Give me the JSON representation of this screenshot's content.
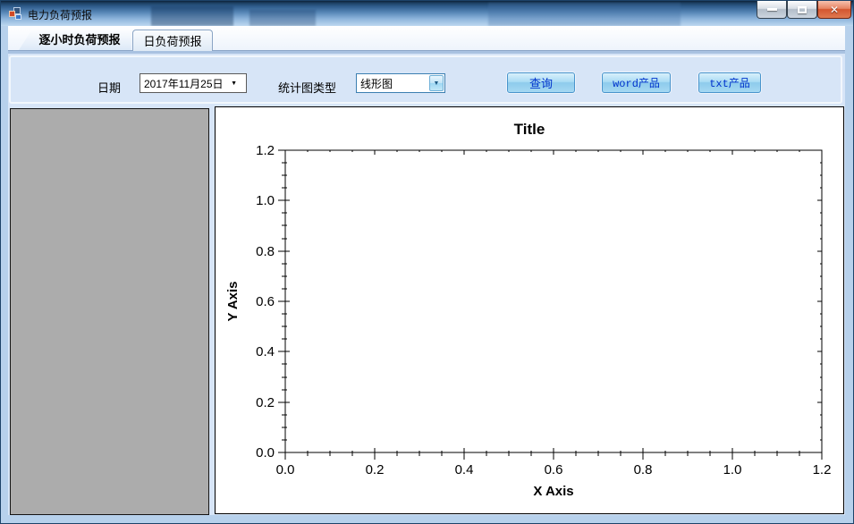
{
  "window": {
    "title": "电力负荷预报"
  },
  "icons": {
    "dropdown_arrow": "▼",
    "close_glyph": "✕"
  },
  "tabs": [
    {
      "label": "逐小时负荷预报",
      "active": true
    },
    {
      "label": "日负荷预报",
      "active": false
    }
  ],
  "toolbar": {
    "date_label": "日期",
    "date_value": "2017年11月25日",
    "chart_type_label": "统计图类型",
    "chart_type_value": "线形图",
    "buttons": [
      {
        "label": "查询"
      },
      {
        "label": "word产品"
      },
      {
        "label": "txt产品"
      }
    ]
  },
  "chart_data": {
    "type": "line",
    "title": "Title",
    "xlabel": "X Axis",
    "ylabel": "Y Axis",
    "xlim": [
      0.0,
      1.2
    ],
    "ylim": [
      0.0,
      1.2
    ],
    "xticks": [
      0.0,
      0.2,
      0.4,
      0.6,
      0.8,
      1.0,
      1.2
    ],
    "yticks": [
      0.0,
      0.2,
      0.4,
      0.6,
      0.8,
      1.0,
      1.2
    ],
    "x_minor_step": 0.05,
    "y_minor_step": 0.05,
    "tick_decimals": 1,
    "grid": false,
    "legend": false,
    "series": []
  },
  "colors": {
    "titlebar_top": "#0d2339",
    "titlebar_bottom": "#bdd8f0",
    "frame_band": "#b7d1ec",
    "page_bg": "#d7e5f7",
    "left_panel_gray": "#acacac",
    "button_face_top": "#d9f0fb",
    "button_face_bottom": "#a5d8f2",
    "button_border": "#4a94cc",
    "button_text": "#0033cc",
    "combo_focus_border": "#3c7fb1",
    "chart_axis": "#000000"
  }
}
